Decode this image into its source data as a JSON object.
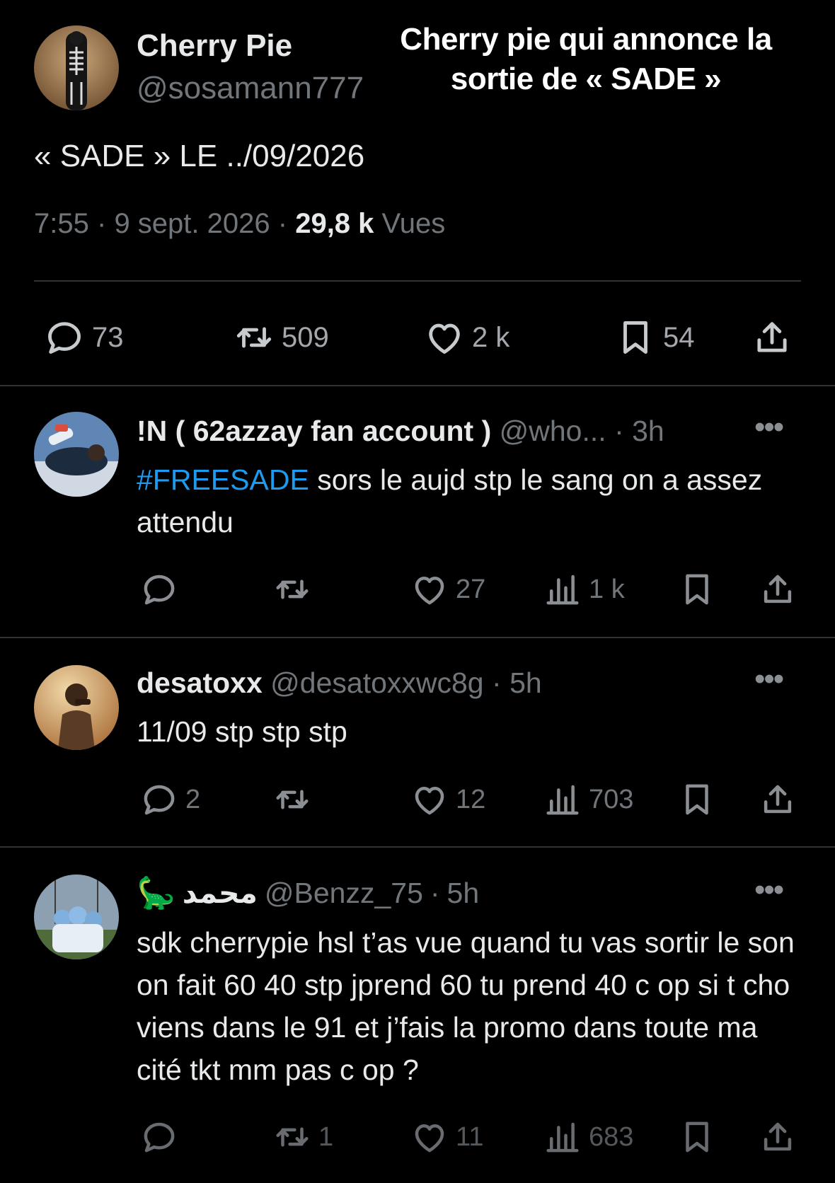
{
  "caption": "Cherry pie qui annonce la sortie de « SADE »",
  "main_tweet": {
    "avatar": "skeleton-avatar",
    "display_name": "Cherry Pie",
    "handle": "@sosamann777",
    "text": "« SADE » LE ../09/2026",
    "time": "7:55",
    "date": "9 sept. 2026",
    "views_count": "29,8 k",
    "views_label": "Vues",
    "stats": {
      "replies": "73",
      "retweets": "509",
      "likes": "2 k",
      "bookmarks": "54"
    }
  },
  "replies": [
    {
      "avatar": "person-lying-avatar",
      "display_name": "!N ( 62azzay fan account )",
      "handle": "@who...",
      "age": "3h",
      "hashtag": "#FREESADE",
      "text": " sors le aujd stp le sang on a assez attendu",
      "stats": {
        "replies": "",
        "retweets": "",
        "likes": "27",
        "views": "1 k"
      }
    },
    {
      "avatar": "kid-photo-avatar",
      "display_name": "desatoxx",
      "handle": "@desatoxxwc8g",
      "age": "5h",
      "text": "11/09 stp stp stp",
      "stats": {
        "replies": "2",
        "retweets": "",
        "likes": "12",
        "views": "703"
      }
    },
    {
      "avatar": "football-team-avatar",
      "emoji": "🦕",
      "display_name": "محمد",
      "handle": "@Benzz_75",
      "age": "5h",
      "text": "sdk cherrypie hsl t’as vue quand tu vas sortir le son on fait 60 40 stp jprend 60 tu prend 40 c op si t cho viens dans le 91 et j’fais la promo dans toute ma cité tkt mm pas c op ?",
      "stats": {
        "replies": "",
        "retweets": "1",
        "likes": "11",
        "views": "683"
      }
    }
  ],
  "separator": "·",
  "colors": {
    "background": "#000000",
    "text": "#e7e9ea",
    "muted": "#71767b",
    "link": "#1d9bf0",
    "divider": "#2f3336"
  }
}
